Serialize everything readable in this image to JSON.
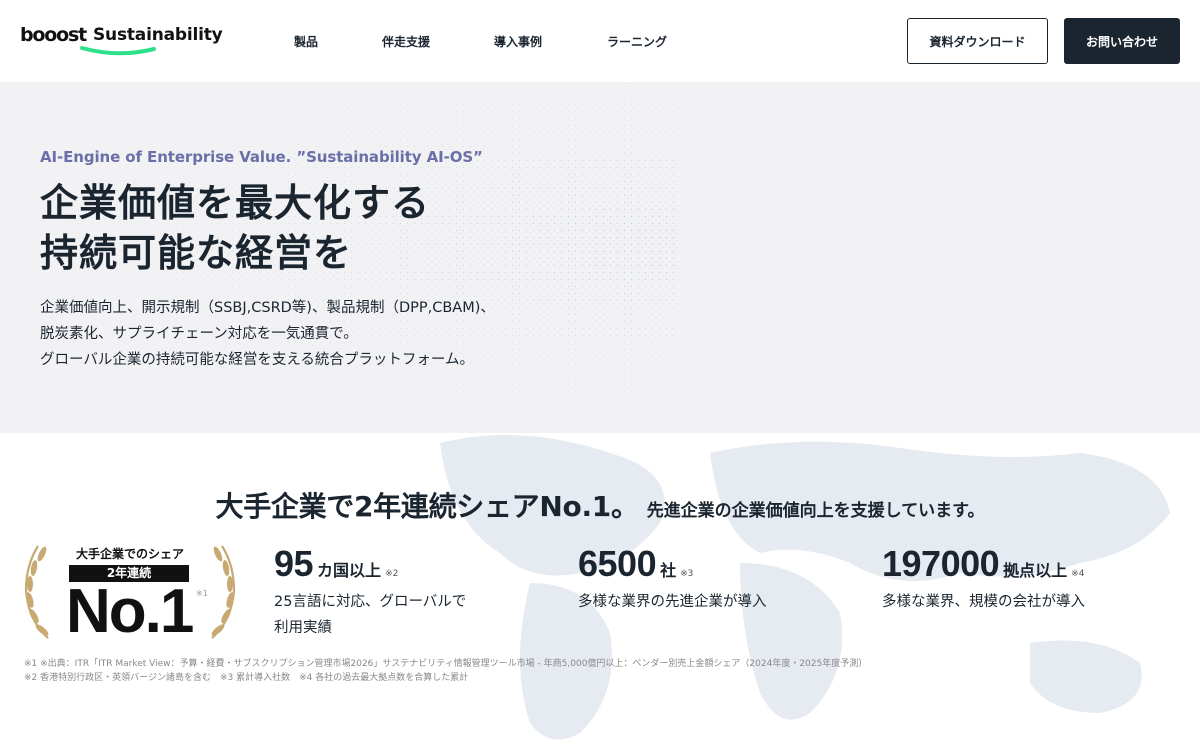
{
  "header": {
    "logo": {
      "brand": "booost",
      "product": "Sustainability"
    },
    "nav": [
      {
        "label": "製品"
      },
      {
        "label": "伴走支援"
      },
      {
        "label": "導入事例"
      },
      {
        "label": "ラーニング"
      }
    ],
    "download_button": "資料ダウンロード",
    "contact_button": "お問い合わせ"
  },
  "hero": {
    "tagline": "AI-Engine of Enterprise Value. ”Sustainability AI-OS”",
    "heading_line1": "企業価値を最大化する",
    "heading_line2": "持続可能な経営を",
    "desc_line1": "企業価値向上、開示規制（SSBJ,CSRD等)、製品規制（DPP,CBAM)、",
    "desc_line2": "脱炭素化、サプライチェーン対応を一気通貫で。",
    "desc_line3": "グローバル企業の持続可能な経営を支える統合プラットフォーム。"
  },
  "stats": {
    "title_main": "大手企業で2年連続シェアNo.1。",
    "title_sub": "先進企業の企業価値向上を支援しています。",
    "badge": {
      "top": "大手企業でのシェア",
      "years": "2年連続",
      "rank": "No.1",
      "note": "※1"
    },
    "items": [
      {
        "number": "95",
        "unit": "カ国以上",
        "note": "※2",
        "desc_line1": "25言語に対応、グローバルで",
        "desc_line2": "利用実績"
      },
      {
        "number": "6500",
        "unit": "社",
        "note": "※3",
        "desc_line1": "多様な業界の先進企業が導入",
        "desc_line2": ""
      },
      {
        "number": "197000",
        "unit": "拠点以上",
        "note": "※4",
        "desc_line1": "多様な業界、規模の会社が導入",
        "desc_line2": ""
      }
    ],
    "footnote1": "※1 ※出典：ITR「ITR Market View：予算・経費・サブスクリプション管理市場2026」サステナビリティ情報管理ツール市場 - 年商5,000億円以上：ベンダー別売上金額シェア（2024年度・2025年度予測）",
    "footnote2": "※2 香港特別行政区・英領バージン諸島を含む　※3 累計導入社数　※4 各社の過去最大拠点数を合算した累計"
  },
  "colors": {
    "navy": "#1b2530",
    "accent_green": "#2ee08a",
    "tagline_purple": "#6b6fa8",
    "laurel_gold": "#c8a971"
  }
}
